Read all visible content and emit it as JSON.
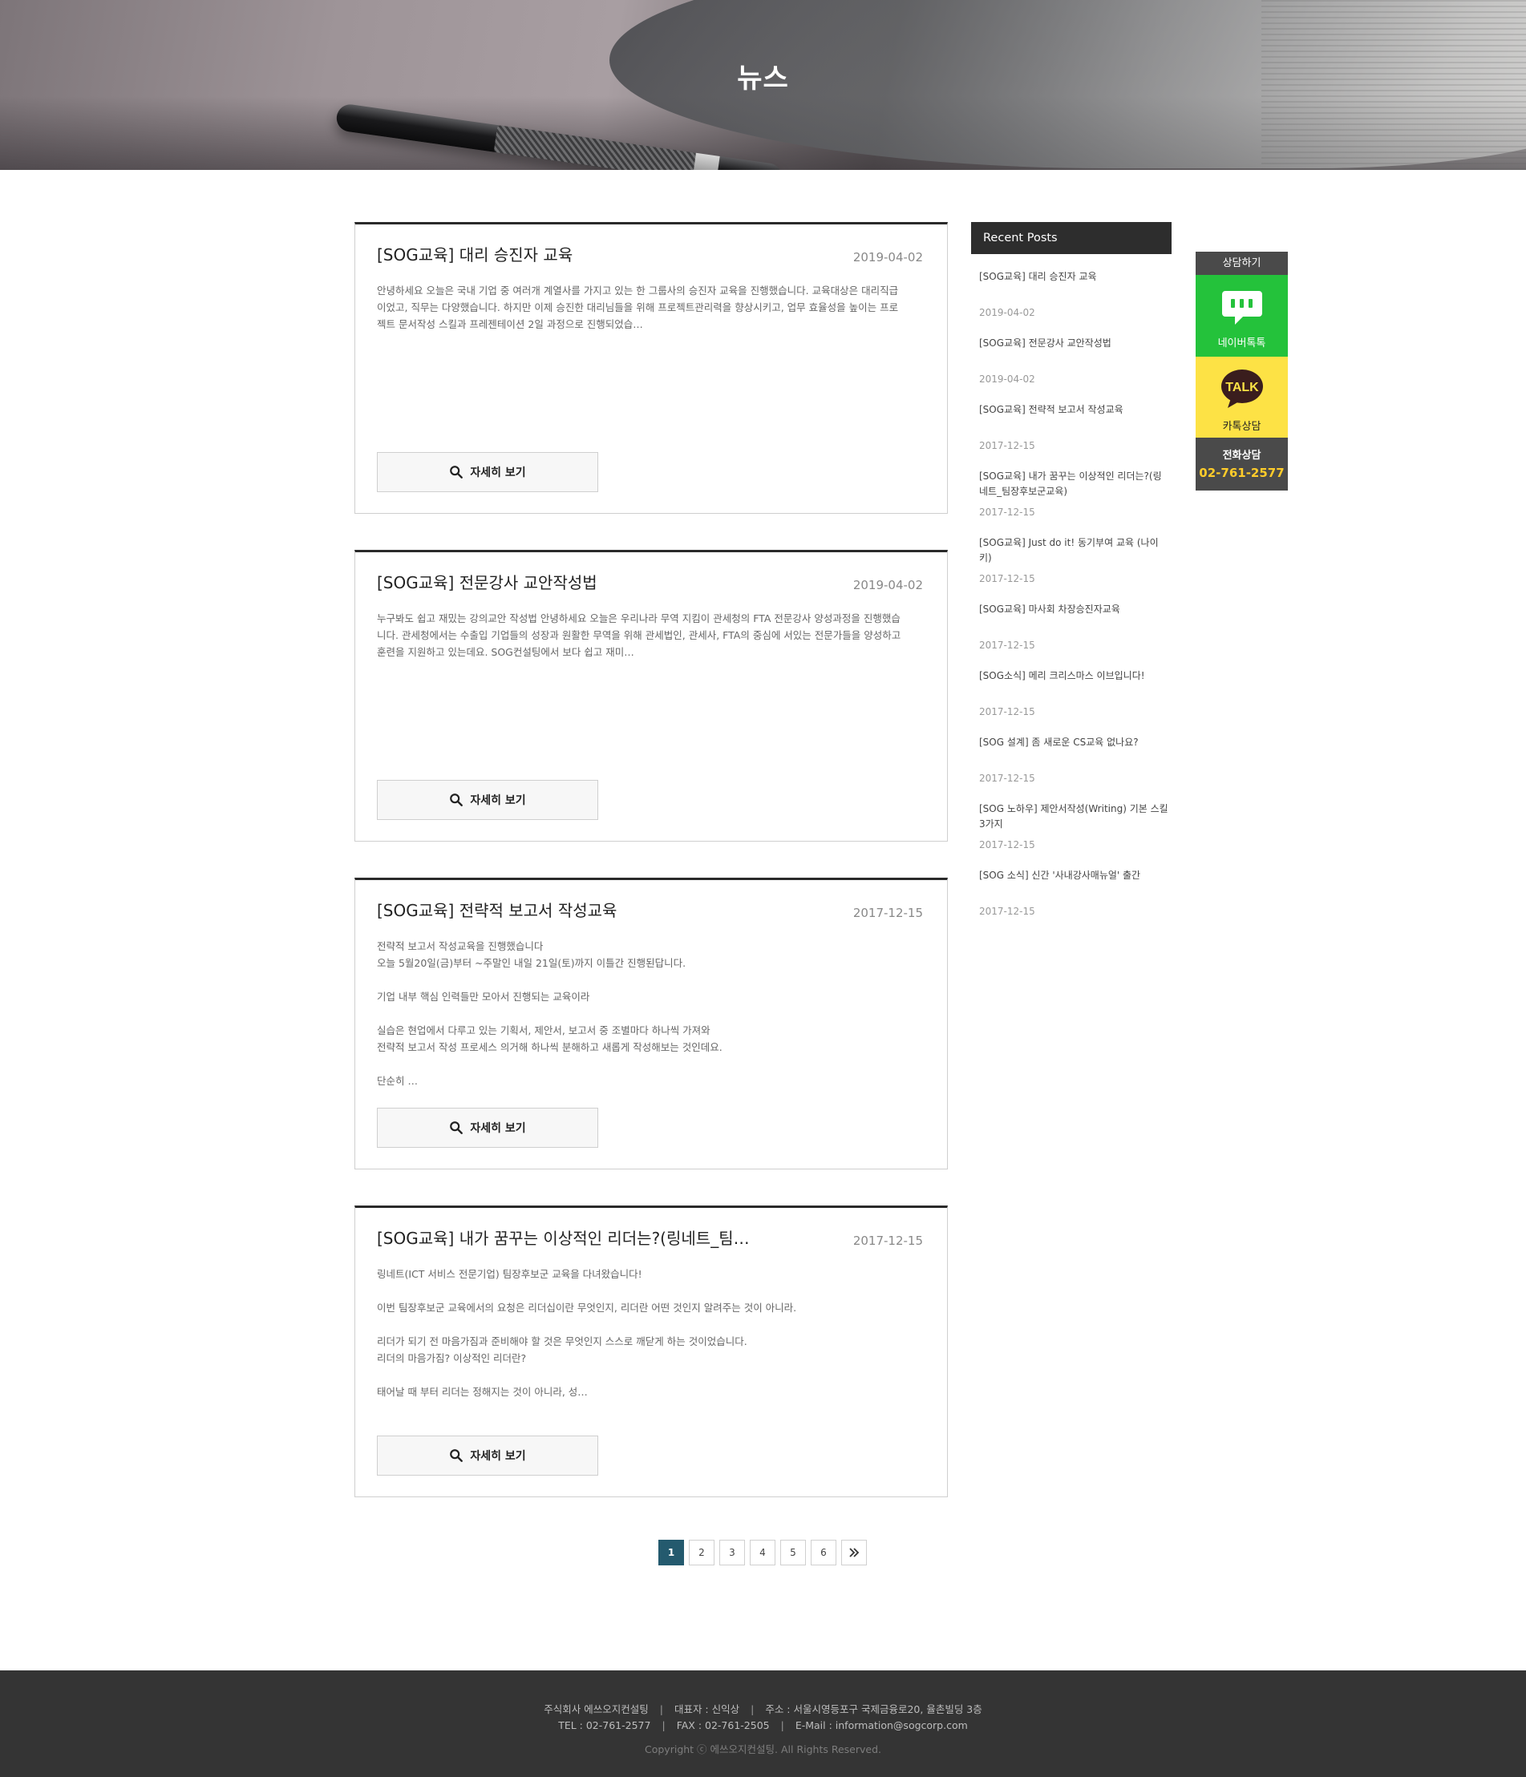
{
  "hero": {
    "title": "뉴스"
  },
  "posts": [
    {
      "title": "[SOG교육] 대리 승진자 교육",
      "date": "2019-04-02",
      "body": [
        "안녕하세요 오늘은 국내 기업 중 여러개 계열사를 가지고 있는 한 그룹사의 승진자 교육을 진행했습니다. 교육대상은 대리직급이었고, 직무는 다양했습니다. 하지만 이제 승진한 대리님들을 위해 프로젝트관리력을 향상시키고, 업무 효율성을 높이는 프로젝트 문서작성 스킬과 프레젠테이션 2일 과정으로 진행되었습…"
      ],
      "more_label": "자세히 보기"
    },
    {
      "title": "[SOG교육] 전문강사 교안작성법",
      "date": "2019-04-02",
      "body": [
        "누구봐도 쉽고 재밌는 강의교안 작성법 안녕하세요 오늘은 우리나라 무역 지킴이 관세청의 FTA 전문강사 양성과정을 진행했습니다. 관세청에서는 수출입 기업들의 성장과 원활한 무역을 위해 관세법인, 관세사, FTA의 중심에 서있는 전문가들을 양성하고 훈련을 지원하고 있는데요. SOG컨설팅에서 보다 쉽고 재미…"
      ],
      "more_label": "자세히 보기"
    },
    {
      "title": "[SOG교육] 전략적 보고서 작성교육",
      "date": "2017-12-15",
      "body": [
        "전략적 보고서 작성교육을 진행했습니다",
        "오늘 5월20일(금)부터 ~주말인 내일 21일(토)까지 이틀간 진행된답니다.",
        "기업 내부 핵심 인력들만 모아서 진행되는 교육이라",
        "실습은 현업에서 다루고 있는 기획서, 제안서, 보고서 중 조별마다 하나씩 가져와",
        "전략적 보고서 작성 프로세스 의거해 하나씩 분해하고 새롭게 작성해보는 것인데요.",
        "단순히 …"
      ],
      "more_label": "자세히 보기"
    },
    {
      "title": "[SOG교육] 내가 꿈꾸는 이상적인 리더는?(링네트_팀…",
      "date": "2017-12-15",
      "body": [
        "링네트(ICT 서비스 전문기업) 팀장후보군 교육을 다녀왔습니다!",
        "이번 팀장후보군 교육에서의 요청은 리더십이란 무엇인지, 리더란 어떤 것인지 알려주는 것이 아니라.",
        "리더가 되기 전 마음가짐과 준비해야 할 것은 무엇인지 스스로 깨닫게 하는 것이었습니다.",
        "리더의 마음가짐? 이상적인 리더란?",
        "태어날 때 부터 리더는 정해지는 것이 아니라, 성…"
      ],
      "more_label": "자세히 보기"
    }
  ],
  "sidebar": {
    "heading": "Recent Posts",
    "items": [
      {
        "title": "[SOG교육] 대리 승진자 교육",
        "date": "2019-04-02"
      },
      {
        "title": "[SOG교육] 전문강사 교안작성법",
        "date": "2019-04-02"
      },
      {
        "title": "[SOG교육] 전략적 보고서 작성교육",
        "date": "2017-12-15"
      },
      {
        "title": "[SOG교육] 내가 꿈꾸는 이상적인 리더는?(링네트_팀장후보군교육)",
        "date": "2017-12-15"
      },
      {
        "title": "[SOG교육] Just do it! 동기부여 교육 (나이키)",
        "date": "2017-12-15"
      },
      {
        "title": "[SOG교육] 마사회 차장승진자교육",
        "date": "2017-12-15"
      },
      {
        "title": "[SOG소식] 메리 크리스마스 이브입니다!",
        "date": "2017-12-15"
      },
      {
        "title": "[SOG 설계] 좀 새로운 CS교육 없나요?",
        "date": "2017-12-15"
      },
      {
        "title": "[SOG 노하우] 제안서작성(Writing) 기본 스킬 3가지",
        "date": "2017-12-15"
      },
      {
        "title": "[SOG 소식] 신간 '사내강사매뉴얼' 출간",
        "date": "2017-12-15"
      }
    ]
  },
  "consult": {
    "heading": "상담하기",
    "naver_label": "네이버톡톡",
    "kakao_label": "카톡상담",
    "kakao_icon_text": "TALK",
    "phone_label": "전화상담",
    "phone_number": "02-761-2577",
    "naver_color": "#24c23b",
    "kakao_color": "#fde245"
  },
  "pagination": {
    "pages": [
      "1",
      "2",
      "3",
      "4",
      "5",
      "6"
    ],
    "current": "1",
    "next_icon": "double-chevron-right-icon",
    "accent": "#245a6e"
  },
  "footer": {
    "company": "주식회사 에쓰오지컨설팅",
    "ceo": "대표자 : 신익상",
    "address": "주소 : 서울시영등포구 국제금융로20, 율촌빌딩 3층",
    "tel": "TEL : 02-761-2577",
    "fax": "FAX : 02-761-2505",
    "email": "E-Mail : information@sogcorp.com",
    "copyright": "Copyright ⓒ 에쓰오지컨설팅. All Rights Reserved."
  }
}
